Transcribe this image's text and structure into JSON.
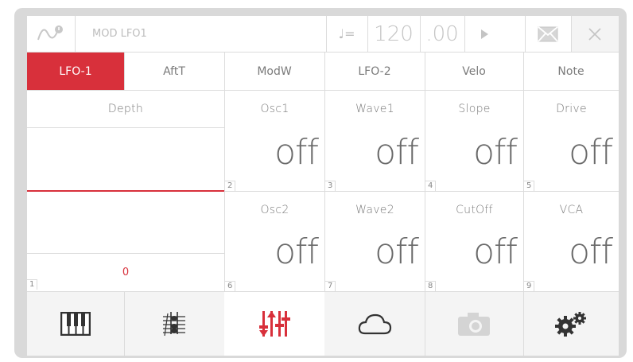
{
  "header": {
    "title": "MOD LFO1",
    "tempo_symbol": "♩=",
    "bpm": "120",
    "bpm_frac": ".00"
  },
  "tabs": [
    {
      "label": "LFO-1",
      "active": true
    },
    {
      "label": "AftT",
      "active": false
    },
    {
      "label": "ModW",
      "active": false
    },
    {
      "label": "LFO-2",
      "active": false
    },
    {
      "label": "Velo",
      "active": false
    },
    {
      "label": "Note",
      "active": false
    }
  ],
  "left_panel": {
    "depth_label": "Depth",
    "depth_value": "0",
    "slot_number": "1"
  },
  "knobs": [
    {
      "label": "Osc1",
      "value": "off",
      "slot": "2"
    },
    {
      "label": "Wave1",
      "value": "off",
      "slot": "3"
    },
    {
      "label": "Slope",
      "value": "off",
      "slot": "4"
    },
    {
      "label": "Drive",
      "value": "off",
      "slot": "5"
    },
    {
      "label": "Osc2",
      "value": "off",
      "slot": "6"
    },
    {
      "label": "Wave2",
      "value": "off",
      "slot": "7"
    },
    {
      "label": "CutOff",
      "value": "off",
      "slot": "8"
    },
    {
      "label": "VCA",
      "value": "off",
      "slot": "9"
    }
  ],
  "bottom_bar": [
    {
      "icon": "piano-keys-icon"
    },
    {
      "icon": "sheet-music-icon"
    },
    {
      "icon": "mixer-sliders-icon",
      "active": true
    },
    {
      "icon": "cloud-icon"
    },
    {
      "icon": "camera-icon",
      "disabled": true
    },
    {
      "icon": "gears-icon"
    }
  ],
  "colors": {
    "accent": "#d8303b",
    "frame": "#d9d9d9",
    "grid": "#dcdcdc",
    "text": "#6a6a6a"
  }
}
